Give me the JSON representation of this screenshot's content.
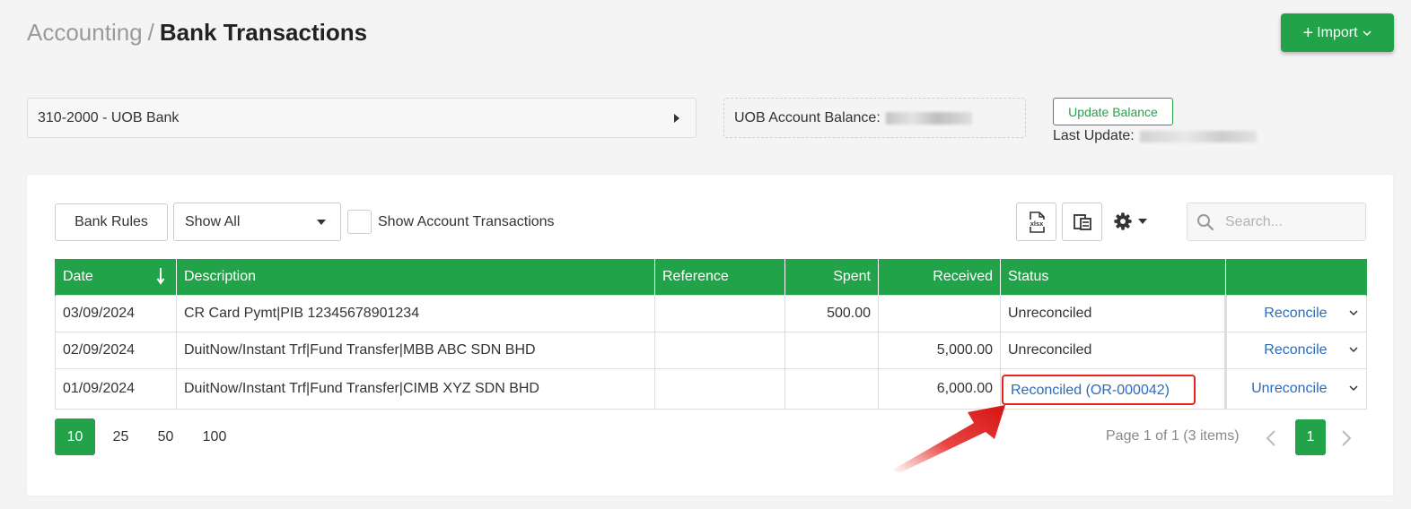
{
  "breadcrumb": {
    "parent": "Accounting",
    "separator": "/",
    "current": "Bank Transactions"
  },
  "header": {
    "import_label": "Import"
  },
  "account": {
    "selected": "310-2000 - UOB Bank"
  },
  "balance": {
    "label": "UOB Account Balance:",
    "update_button": "Update Balance",
    "last_update_label": "Last Update:"
  },
  "toolbar": {
    "bank_rules_label": "Bank Rules",
    "filter_value": "Show All",
    "show_account_tx_label": "Show Account Transactions",
    "search_placeholder": "Search..."
  },
  "table": {
    "columns": [
      "Date",
      "Description",
      "Reference",
      "Spent",
      "Received",
      "Status",
      ""
    ],
    "rows": [
      {
        "date": "03/09/2024",
        "description": "CR Card Pymt|PIB 12345678901234",
        "reference": "",
        "spent": "500.00",
        "received": "",
        "status": "Unreconciled",
        "action": "Reconcile"
      },
      {
        "date": "02/09/2024",
        "description": "DuitNow/Instant Trf|Fund Transfer|MBB ABC SDN BHD",
        "reference": "",
        "spent": "",
        "received": "5,000.00",
        "status": "Unreconciled",
        "action": "Reconcile"
      },
      {
        "date": "01/09/2024",
        "description": "DuitNow/Instant Trf|Fund Transfer|CIMB XYZ SDN BHD",
        "reference": "",
        "spent": "",
        "received": "6,000.00",
        "status": "Reconciled (OR-000042)",
        "action": "Unreconcile"
      }
    ]
  },
  "pagination": {
    "page_sizes": [
      "10",
      "25",
      "50",
      "100"
    ],
    "active_size": "10",
    "info": "Page 1 of 1 (3 items)",
    "current_page": "1"
  },
  "colors": {
    "brand_green": "#22a34a",
    "unreconciled": "#e3231e",
    "link_blue": "#2a6bbf"
  },
  "icons": [
    "chevron-down-icon",
    "caret-right-icon",
    "xlsx-export-icon",
    "column-chooser-icon",
    "gear-icon",
    "search-icon",
    "sort-down-icon",
    "chevron-left-icon",
    "chevron-right-icon"
  ]
}
